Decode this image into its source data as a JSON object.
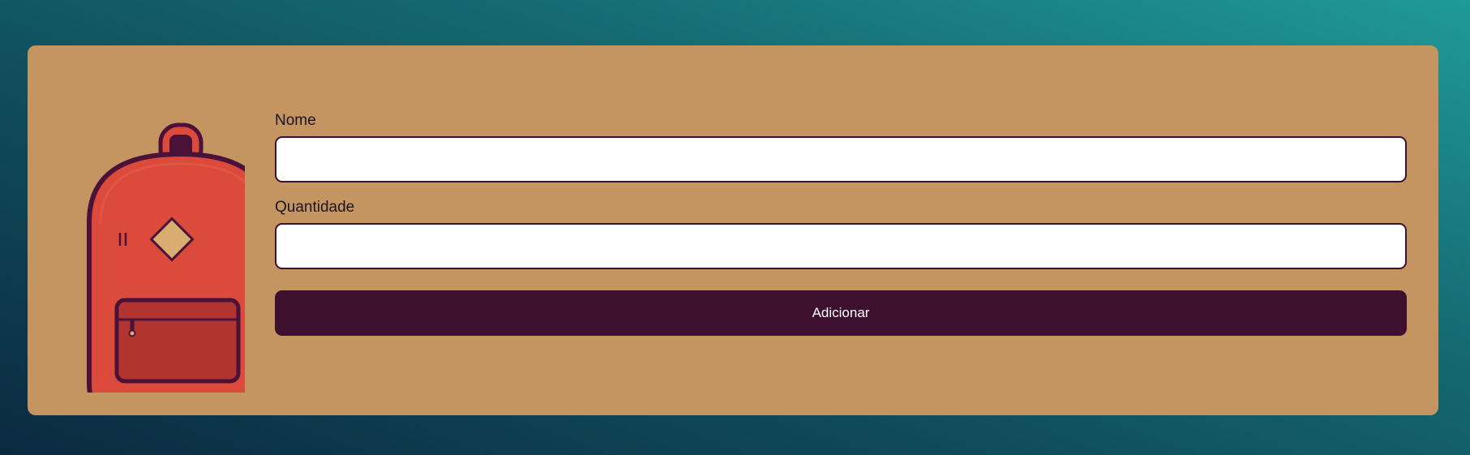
{
  "illustration": {
    "icon": "backpack-icon",
    "colors": {
      "body": "#db4a3b",
      "outline": "#4a1238",
      "pocket": "#b1342f",
      "patch": "#d9ac70"
    }
  },
  "form": {
    "name_label": "Nome",
    "name_value": "",
    "quantity_label": "Quantidade",
    "quantity_value": "",
    "submit_label": "Adicionar"
  },
  "colors": {
    "card": "#c49461",
    "button": "#3d102d",
    "input_border": "#3d1130"
  }
}
